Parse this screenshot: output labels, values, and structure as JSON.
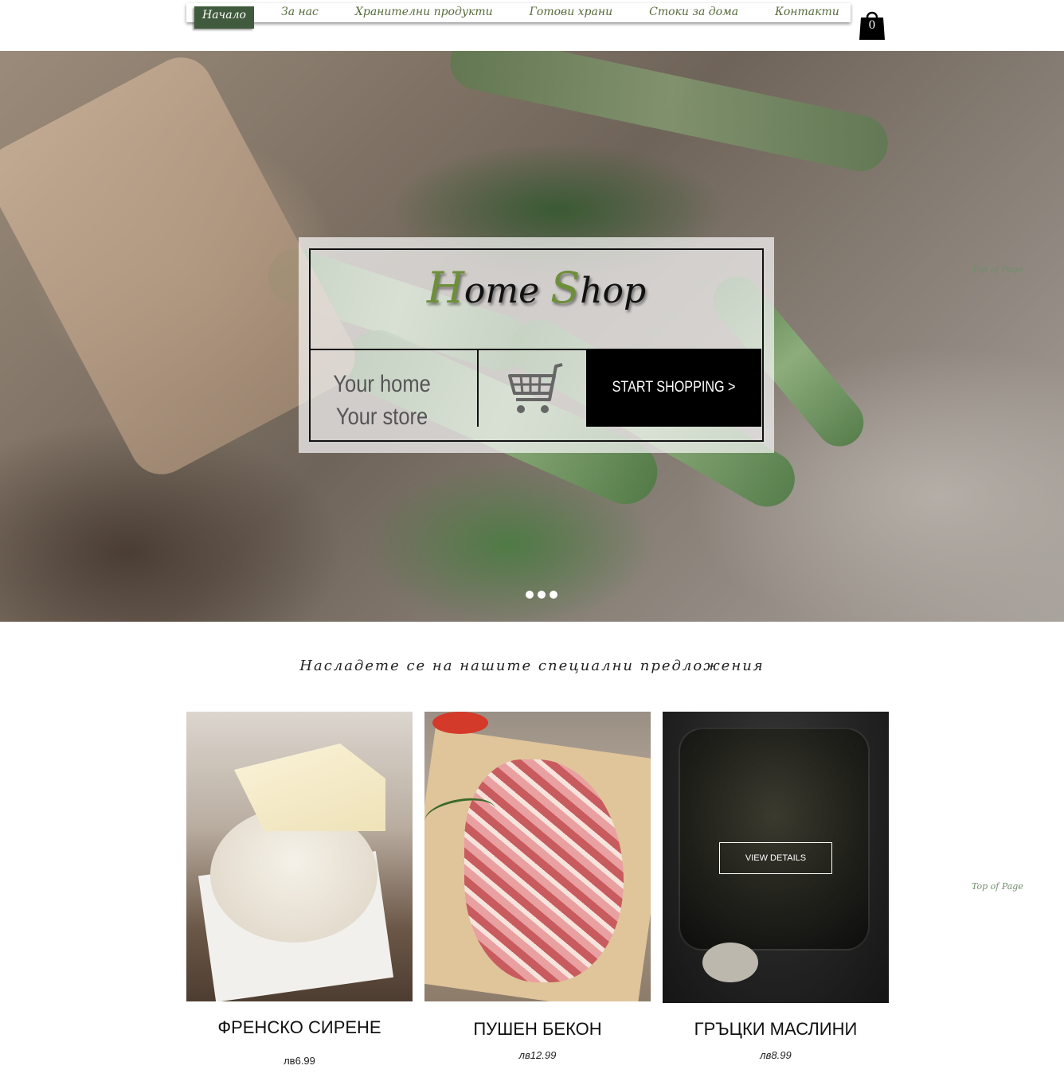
{
  "nav": {
    "items": [
      {
        "label": "Начало",
        "active": true
      },
      {
        "label": "За нас"
      },
      {
        "label": "Хранителни продукти"
      },
      {
        "label": "Готови храни"
      },
      {
        "label": "Стоки за дома"
      },
      {
        "label": "Контакти"
      }
    ],
    "cart_count": "0",
    "cart_icon": "shopping-bag-icon"
  },
  "hero": {
    "title_h": "H",
    "title_ome": "ome ",
    "title_s": "S",
    "title_hop": "hop",
    "tagline_line1": "Your home",
    "tagline_line2": "Your store",
    "cart_icon": "shopping-cart-icon",
    "cta": "START SHOPPING >",
    "slider_dots": 3
  },
  "top_link": "Top of Page",
  "offers": {
    "heading": "Насладете се на нашите специални предложения",
    "view_details": "VIEW DETAILS",
    "products": [
      {
        "name": "ФРЕНСКО СИРЕНЕ",
        "price": "лв6.99"
      },
      {
        "name": "ПУШЕН БЕКОН",
        "price": "лв12.99"
      },
      {
        "name": "ГРЪЦКИ МАСЛИНИ",
        "price": "лв8.99"
      }
    ]
  },
  "colors": {
    "nav_active_bg": "#3f5a3c",
    "nav_text": "#556b3a",
    "accent_green": "#6d8f3a",
    "button_bg": "#000000"
  }
}
